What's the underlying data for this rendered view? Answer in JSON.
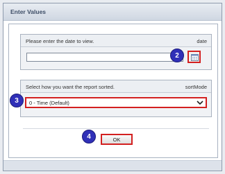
{
  "dialog": {
    "title": "Enter Values"
  },
  "date_panel": {
    "prompt": "Please enter the date to view.",
    "param_name": "date",
    "value": ""
  },
  "sort_panel": {
    "prompt": "Select how you want the report sorted.",
    "param_name": "sortMode",
    "selected": "0 - Time (Default)"
  },
  "ok_button": {
    "label": "OK"
  },
  "markers": {
    "calendar": "2",
    "sort": "3",
    "ok": "4"
  },
  "colors": {
    "highlight": "#d32020",
    "marker": "#3030b8"
  }
}
